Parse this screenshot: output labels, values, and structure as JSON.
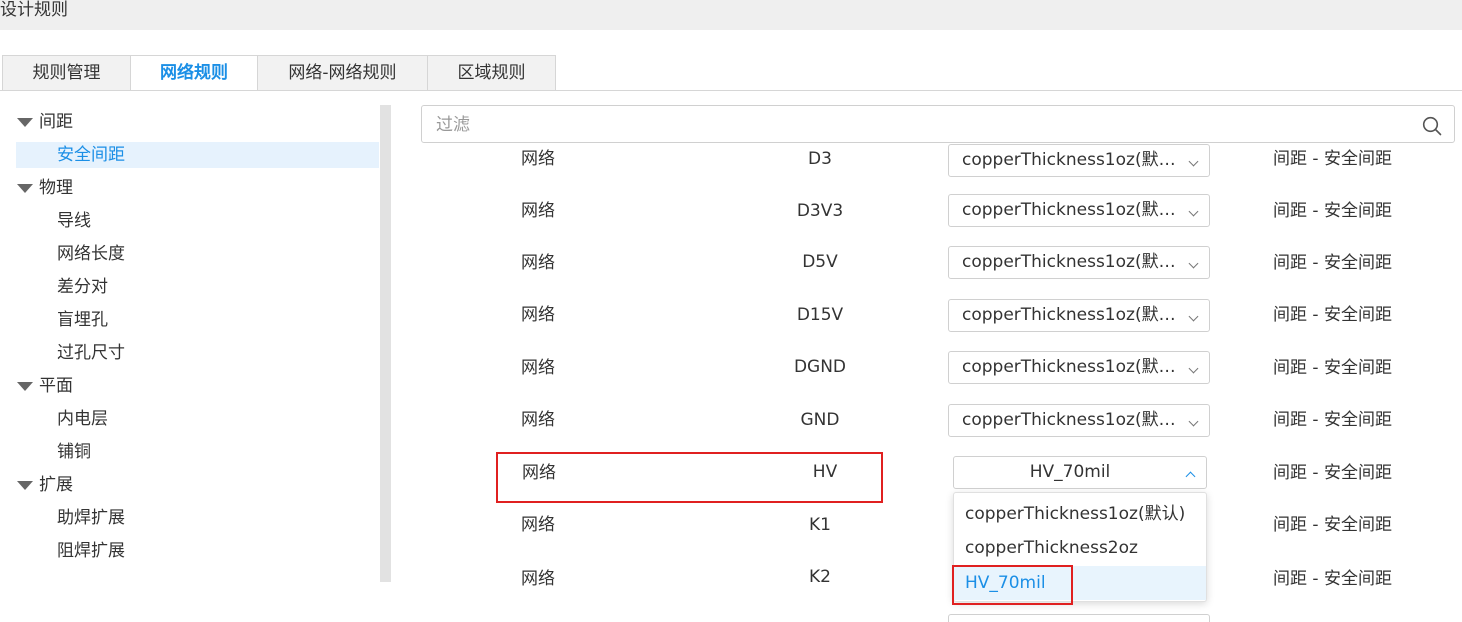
{
  "window": {
    "title": "设计规则"
  },
  "tabs": [
    {
      "label": "规则管理"
    },
    {
      "label": "网络规则"
    },
    {
      "label": "网络-网络规则"
    },
    {
      "label": "区域规则"
    }
  ],
  "tree": {
    "groups": [
      {
        "label": "间距",
        "items": [
          {
            "label": "安全间距"
          }
        ]
      },
      {
        "label": "物理",
        "items": [
          {
            "label": "导线"
          },
          {
            "label": "网络长度"
          },
          {
            "label": "差分对"
          },
          {
            "label": "盲埋孔"
          },
          {
            "label": "过孔尺寸"
          }
        ]
      },
      {
        "label": "平面",
        "items": [
          {
            "label": "内电层"
          },
          {
            "label": "铺铜"
          }
        ]
      },
      {
        "label": "扩展",
        "items": [
          {
            "label": "助焊扩展"
          },
          {
            "label": "阻焊扩展"
          }
        ]
      }
    ],
    "selected": "安全间距"
  },
  "filter": {
    "placeholder": "过滤",
    "value": ""
  },
  "rows": [
    {
      "type": "网络",
      "net": "D3",
      "value": "copperThickness1oz(默…",
      "rule": "间距 - 安全间距"
    },
    {
      "type": "网络",
      "net": "D3V3",
      "value": "copperThickness1oz(默…",
      "rule": "间距 - 安全间距"
    },
    {
      "type": "网络",
      "net": "D5V",
      "value": "copperThickness1oz(默…",
      "rule": "间距 - 安全间距"
    },
    {
      "type": "网络",
      "net": "D15V",
      "value": "copperThickness1oz(默…",
      "rule": "间距 - 安全间距"
    },
    {
      "type": "网络",
      "net": "DGND",
      "value": "copperThickness1oz(默…",
      "rule": "间距 - 安全间距"
    },
    {
      "type": "网络",
      "net": "GND",
      "value": "copperThickness1oz(默…",
      "rule": "间距 - 安全间距"
    },
    {
      "type": "网络",
      "net": "HV",
      "value": "HV_70mil",
      "rule": "间距 - 安全间距"
    },
    {
      "type": "网络",
      "net": "K1",
      "value": "",
      "rule": "间距 - 安全间距"
    },
    {
      "type": "网络",
      "net": "K2",
      "value": "",
      "rule": "间距 - 安全间距"
    },
    {
      "type": "网络",
      "net": "",
      "value": "",
      "rule": ""
    }
  ],
  "dropdown": {
    "options": [
      {
        "label": "copperThickness1oz(默认)"
      },
      {
        "label": "copperThickness2oz"
      },
      {
        "label": "HV_70mil"
      }
    ],
    "selected": "HV_70mil"
  },
  "colors": {
    "accent": "#1b8fe6",
    "highlight": "#e02020",
    "selected_bg": "#e6f2fd"
  }
}
